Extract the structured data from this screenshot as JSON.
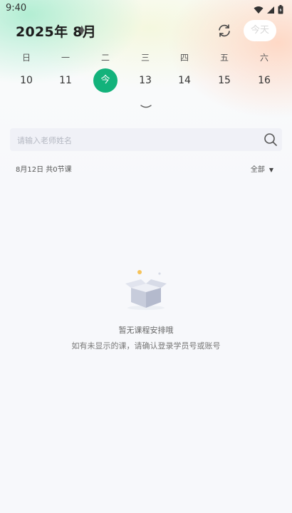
{
  "status_bar": {
    "time": "9:40"
  },
  "header": {
    "month_title": "2025年 8月",
    "today_button": "今天"
  },
  "week": {
    "weekdays": [
      "日",
      "一",
      "二",
      "三",
      "四",
      "五",
      "六"
    ],
    "dates": [
      "10",
      "11",
      "今",
      "13",
      "14",
      "15",
      "16"
    ],
    "selected_index": 2,
    "accent_color": "#13b27b"
  },
  "search": {
    "placeholder": "请输入老师姓名"
  },
  "info": {
    "summary": "8月12日 共0节课",
    "filter_label": "全部"
  },
  "empty": {
    "title": "暂无课程安排哦",
    "subtitle": "如有未显示的课，请确认登录学员号或账号"
  },
  "icons": {
    "signal": "signal-icon",
    "wifi": "wifi-icon",
    "battery": "battery-icon",
    "refresh": "refresh-icon",
    "search": "search-icon",
    "expand": "chevron-down-icon",
    "empty": "empty-box-icon"
  }
}
